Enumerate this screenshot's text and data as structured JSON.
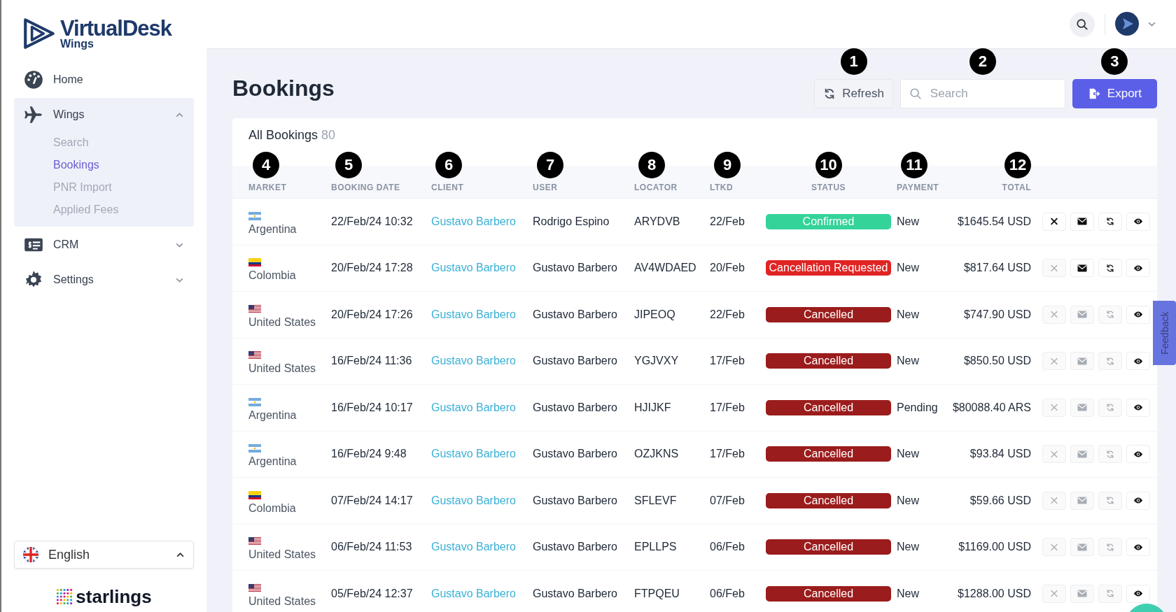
{
  "logo": {
    "title": "VirtualDesk",
    "subtitle": "Wings"
  },
  "sidebar": {
    "items": [
      {
        "label": "Home"
      },
      {
        "label": "Wings",
        "expanded": true,
        "children": [
          {
            "label": "Search",
            "selected": false
          },
          {
            "label": "Bookings",
            "selected": true
          },
          {
            "label": "PNR Import",
            "selected": false
          },
          {
            "label": "Applied Fees",
            "selected": false
          }
        ]
      },
      {
        "label": "CRM",
        "expanded": false
      },
      {
        "label": "Settings",
        "expanded": false
      }
    ],
    "language": {
      "label": "English",
      "expanded": true
    },
    "partner_logo": "starlings"
  },
  "page": {
    "title": "Bookings"
  },
  "toolbar": {
    "refresh": {
      "label": "Refresh",
      "callout": "1"
    },
    "search": {
      "placeholder": "Search",
      "callout": "2"
    },
    "export": {
      "label": "Export",
      "callout": "3"
    }
  },
  "table": {
    "title": "All Bookings",
    "count": "80",
    "columns": [
      {
        "label": "MARKET",
        "callout": "4"
      },
      {
        "label": "BOOKING DATE",
        "callout": "5"
      },
      {
        "label": "CLIENT",
        "callout": "6"
      },
      {
        "label": "USER",
        "callout": "7"
      },
      {
        "label": "LOCATOR",
        "callout": "8"
      },
      {
        "label": "LTKD",
        "callout": "9"
      },
      {
        "label": "STATUS",
        "callout": "10"
      },
      {
        "label": "PAYMENT",
        "callout": "11"
      },
      {
        "label": "TOTAL",
        "callout": "12"
      }
    ],
    "rows": [
      {
        "kind": "ar",
        "market": "Argentina",
        "date": "22/Feb/24 10:32",
        "client": "Gustavo Barbero",
        "user": "Rodrigo Espino",
        "locator": "ARYDVB",
        "ltkd": "22/Feb",
        "status": "Confirmed",
        "color": "#34d399",
        "payment": "New",
        "total": "$1645.54 USD",
        "cancel_enabled": true,
        "email_enabled": true,
        "resync_enabled": true
      },
      {
        "kind": "co",
        "market": "Colombia",
        "date": "20/Feb/24 17:28",
        "client": "Gustavo Barbero",
        "user": "Gustavo Barbero",
        "locator": "AV4WDAED",
        "ltkd": "20/Feb",
        "status": "Cancellation Requested",
        "color": "#e02424",
        "payment": "New",
        "total": "$817.64 USD",
        "cancel_enabled": false,
        "email_enabled": true,
        "resync_enabled": true
      },
      {
        "kind": "us",
        "market": "United States",
        "date": "20/Feb/24 17:26",
        "client": "Gustavo Barbero",
        "user": "Gustavo Barbero",
        "locator": "JIPEOQ",
        "ltkd": "22/Feb",
        "status": "Cancelled",
        "color": "#9b1c1c",
        "payment": "New",
        "total": "$747.90 USD",
        "cancel_enabled": false,
        "email_enabled": false,
        "resync_enabled": false
      },
      {
        "kind": "us",
        "market": "United States",
        "date": "16/Feb/24 11:36",
        "client": "Gustavo Barbero",
        "user": "Gustavo Barbero",
        "locator": "YGJVXY",
        "ltkd": "17/Feb",
        "status": "Cancelled",
        "color": "#9b1c1c",
        "payment": "New",
        "total": "$850.50 USD",
        "cancel_enabled": false,
        "email_enabled": false,
        "resync_enabled": false
      },
      {
        "kind": "ar",
        "market": "Argentina",
        "date": "16/Feb/24 10:17",
        "client": "Gustavo Barbero",
        "user": "Gustavo Barbero",
        "locator": "HJIJKF",
        "ltkd": "17/Feb",
        "status": "Cancelled",
        "color": "#9b1c1c",
        "payment": "Pending",
        "total": "$80088.40 ARS",
        "cancel_enabled": false,
        "email_enabled": false,
        "resync_enabled": false
      },
      {
        "kind": "ar",
        "market": "Argentina",
        "date": "16/Feb/24 9:48",
        "client": "Gustavo Barbero",
        "user": "Gustavo Barbero",
        "locator": "OZJKNS",
        "ltkd": "17/Feb",
        "status": "Cancelled",
        "color": "#9b1c1c",
        "payment": "New",
        "total": "$93.84 USD",
        "cancel_enabled": false,
        "email_enabled": false,
        "resync_enabled": false
      },
      {
        "kind": "co",
        "market": "Colombia",
        "date": "07/Feb/24 14:17",
        "client": "Gustavo Barbero",
        "user": "Gustavo Barbero",
        "locator": "SFLEVF",
        "ltkd": "07/Feb",
        "status": "Cancelled",
        "color": "#9b1c1c",
        "payment": "New",
        "total": "$59.66 USD",
        "cancel_enabled": false,
        "email_enabled": false,
        "resync_enabled": false
      },
      {
        "kind": "us",
        "market": "United States",
        "date": "06/Feb/24 11:53",
        "client": "Gustavo Barbero",
        "user": "Gustavo Barbero",
        "locator": "EPLLPS",
        "ltkd": "06/Feb",
        "status": "Cancelled",
        "color": "#9b1c1c",
        "payment": "New",
        "total": "$1169.00 USD",
        "cancel_enabled": false,
        "email_enabled": false,
        "resync_enabled": false
      },
      {
        "kind": "us",
        "market": "United States",
        "date": "05/Feb/24 12:37",
        "client": "Gustavo Barbero",
        "user": "Gustavo Barbero",
        "locator": "FTPQEU",
        "ltkd": "06/Feb",
        "status": "Cancelled",
        "color": "#9b1c1c",
        "payment": "New",
        "total": "$1288.00 USD",
        "cancel_enabled": false,
        "email_enabled": false,
        "resync_enabled": false
      }
    ]
  },
  "feedback": {
    "label": "Feedback"
  }
}
